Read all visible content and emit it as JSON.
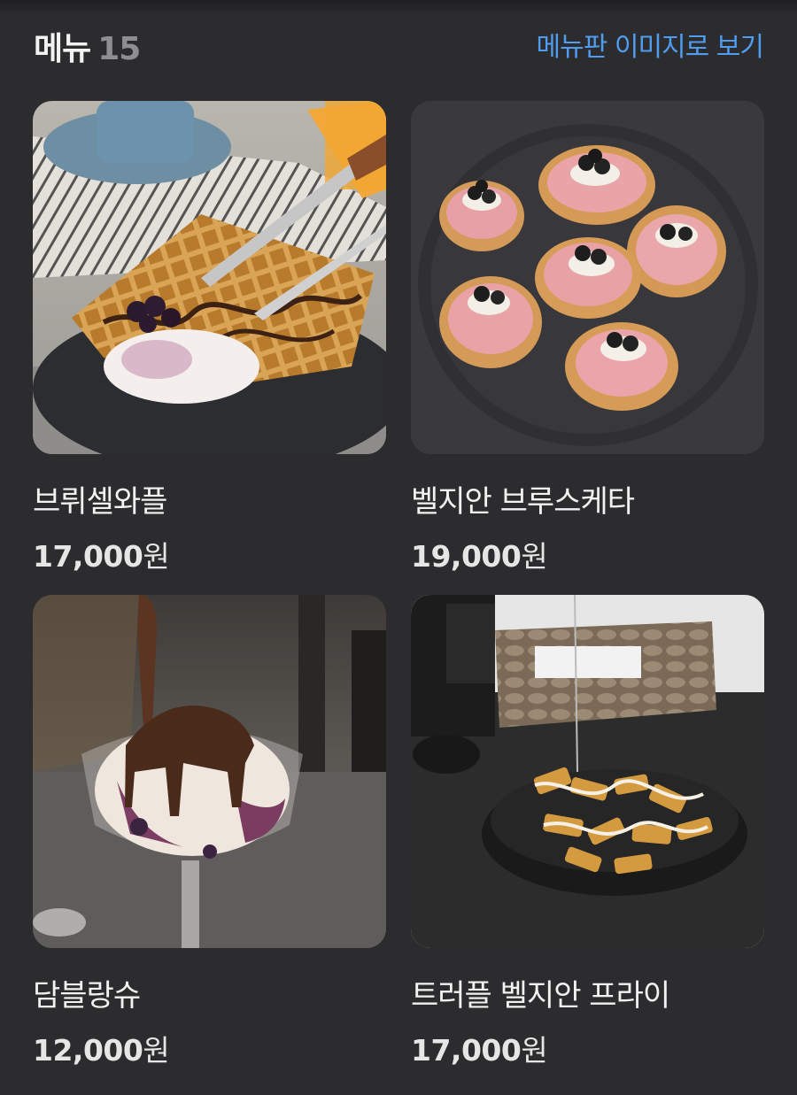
{
  "header": {
    "title": "메뉴",
    "count": "15",
    "view_board_link": "메뉴판 이미지로 보기"
  },
  "menu_items": [
    {
      "name": "브뤼셀와플",
      "price": "17,000",
      "unit": "원",
      "image": "waffle-photo"
    },
    {
      "name": "벨지안 브루스케타",
      "price": "19,000",
      "unit": "원",
      "image": "bruschetta-photo"
    },
    {
      "name": "담블랑슈",
      "price": "12,000",
      "unit": "원",
      "image": "dame-blanche-photo"
    },
    {
      "name": "트러플 벨지안 프라이",
      "price": "17,000",
      "unit": "원",
      "image": "truffle-fries-photo"
    }
  ],
  "colors": {
    "background": "#2c2c2e",
    "link": "#4f9cf0",
    "text": "#f2f2f2",
    "count": "#8d8d92"
  }
}
